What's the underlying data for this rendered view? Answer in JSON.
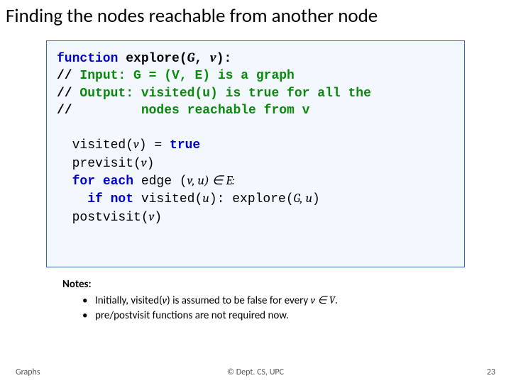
{
  "title": "Finding the nodes reachable from another node",
  "code": {
    "fn_kw": "function",
    "fn_name": "explore",
    "sig_open": "(",
    "sig_G": "G",
    "sig_comma": ", ",
    "sig_v": "v",
    "sig_close": "):",
    "c1_sl": "//",
    "c1": " Input: G = (V, E) is a graph",
    "c2_sl": "//",
    "c2": " Output: visited(u) is true for all the",
    "c3_sl": "//",
    "c3": "         nodes reachable from v",
    "l_visited": "visited(",
    "l_v1": "v",
    "l_paren_close_eq": ") = ",
    "kw_true": "true",
    "l_previsit": "previsit(",
    "l_v2": "v",
    "l_close1": ")",
    "kw_for": "for each",
    "l_edge": " edge (",
    "l_v3": "v",
    "l_comma_u": ", u) ∈ E:",
    "kw_if": "if not",
    "l_visu": " visited(",
    "l_u": "u",
    "l_close_colon": "): ",
    "l_explore_call": "explore(",
    "l_Gu": "G, u",
    "l_close2": ")",
    "l_postvisit": "postvisit(",
    "l_v4": "v",
    "l_close3": ")"
  },
  "notes": {
    "heading": "Notes:",
    "b1_a": "Initially, visited(",
    "b1_v": "v",
    "b1_b": ") is assumed to be false for every ",
    "b1_c": "v ∈ V",
    "b1_d": ".",
    "b2": "pre/postvisit functions are not required now."
  },
  "footer": {
    "left": "Graphs",
    "center": "© Dept. CS, UPC",
    "right": "23"
  }
}
